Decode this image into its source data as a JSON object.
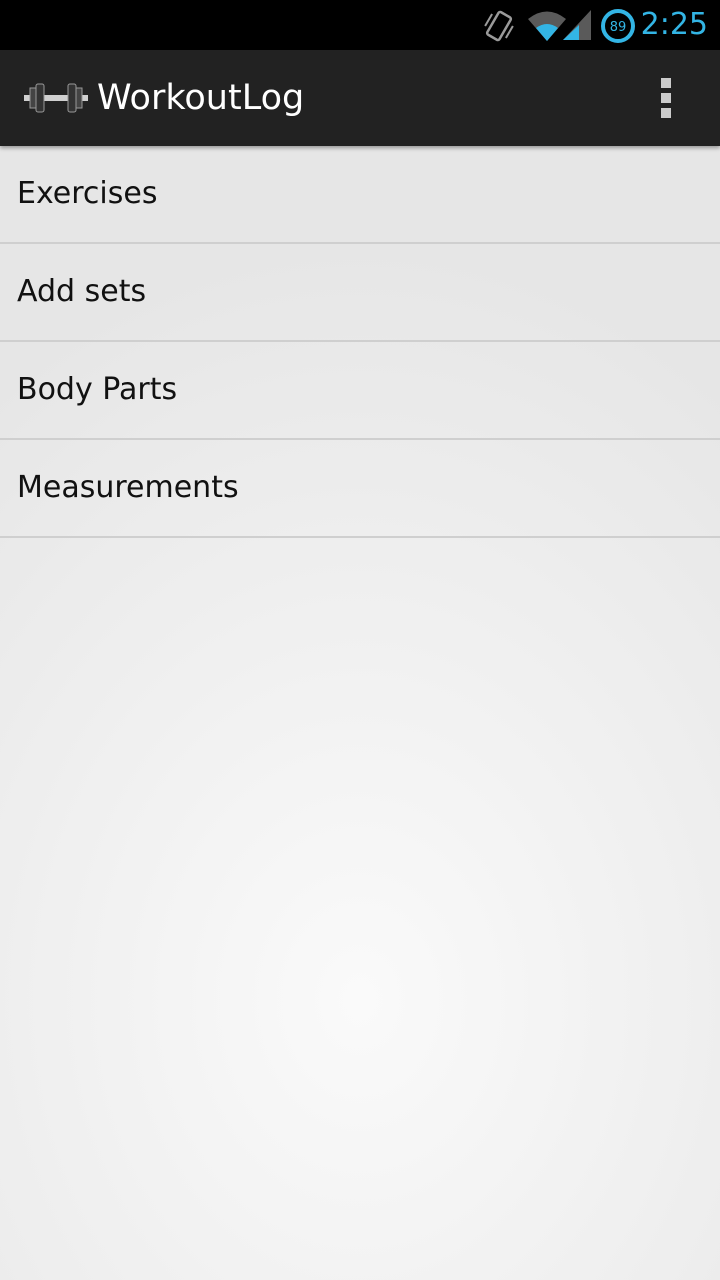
{
  "status_bar": {
    "time": "2:25",
    "battery_level": "89",
    "icons": [
      "vibrate-icon",
      "wifi-icon",
      "signal-icon",
      "battery-icon"
    ]
  },
  "action_bar": {
    "title": "WorkoutLog",
    "app_icon": "dumbbell-icon",
    "overflow_icon": "overflow-menu-icon"
  },
  "menu": {
    "items": [
      {
        "label": "Exercises"
      },
      {
        "label": "Add sets"
      },
      {
        "label": "Body Parts"
      },
      {
        "label": "Measurements"
      }
    ]
  },
  "colors": {
    "accent": "#33b5e5",
    "action_bar": "#222222",
    "status_bar": "#000000"
  }
}
